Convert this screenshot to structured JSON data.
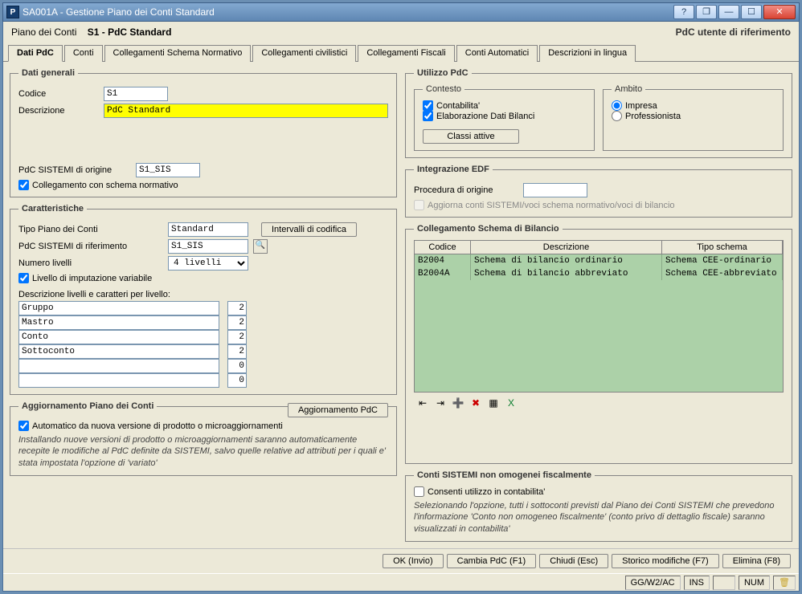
{
  "window": {
    "title": "SA001A - Gestione Piano dei Conti Standard",
    "help_icon": "?",
    "restore_icon": "❐",
    "minimize_icon": "—",
    "maximize_icon": "☐",
    "close_icon": "✕",
    "app_icon": "P"
  },
  "header": {
    "left_label": "Piano dei Conti",
    "code": "S1 -",
    "name": "PdC Standard",
    "right": "PdC utente di riferimento"
  },
  "tabs": {
    "dati_pdc": "Dati PdC",
    "conti": "Conti",
    "coll_schema_norm": "Collegamenti Schema Normativo",
    "coll_civil": "Collegamenti civilistici",
    "coll_fisc": "Collegamenti Fiscali",
    "conti_auto": "Conti Automatici",
    "descr_lingua": "Descrizioni in lingua"
  },
  "dati_generali": {
    "legend": "Dati generali",
    "codice_lbl": "Codice",
    "codice_val": "S1",
    "descr_lbl": "Descrizione",
    "descr_val": "PdC Standard",
    "origine_lbl": "PdC SISTEMI di origine",
    "origine_val": "S1_SIS",
    "chk_coll": "Collegamento con schema normativo"
  },
  "caratteristiche": {
    "legend": "Caratteristiche",
    "tipo_lbl": "Tipo Piano dei Conti",
    "tipo_val": "Standard",
    "intervalli_btn": "Intervalli di codifica",
    "rif_lbl": "PdC SISTEMI di riferimento",
    "rif_val": "S1_SIS",
    "livelli_lbl": "Numero livelli",
    "livelli_val": "4 livelli",
    "chk_imput": "Livello di imputazione variabile",
    "descr_liv_lbl": "Descrizione livelli e caratteri per livello:",
    "levels": [
      {
        "nombre": "Gruppo",
        "num": "2"
      },
      {
        "nombre": "Mastro",
        "num": "2"
      },
      {
        "nombre": "Conto",
        "num": "2"
      },
      {
        "nombre": "Sottoconto",
        "num": "2"
      },
      {
        "nombre": "",
        "num": "0"
      },
      {
        "nombre": "",
        "num": "0"
      }
    ]
  },
  "aggiornamento": {
    "legend": "Aggiornamento Piano dei Conti",
    "btn": "Aggiornamento PdC",
    "chk": "Automatico da nuova versione di prodotto o microaggiornamenti",
    "note": "Installando nuove versioni di prodotto o microaggiornamenti saranno automaticamente recepite le modifiche al PdC definite da SISTEMI, salvo quelle relative ad attributi per i quali e' stata impostata l'opzione di 'variato'"
  },
  "utilizzo": {
    "legend": "Utilizzo PdC",
    "contesto_legend": "Contesto",
    "chk_contab": "Contabilita'",
    "chk_elab": "Elaborazione Dati Bilanci",
    "classi_btn": "Classi attive",
    "ambito_legend": "Ambito",
    "rb_impresa": "Impresa",
    "rb_prof": "Professionista"
  },
  "integrazione": {
    "legend": "Integrazione EDF",
    "proc_lbl": "Procedura di origine",
    "proc_val": "",
    "chk_agg": "Aggiorna conti SISTEMI/voci schema normativo/voci di bilancio"
  },
  "collegamento_schema": {
    "legend": "Collegamento Schema di Bilancio",
    "col_codice": "Codice",
    "col_descr": "Descrizione",
    "col_tipo": "Tipo schema",
    "rows": [
      {
        "codice": "B2004",
        "descr": "Schema di bilancio ordinario",
        "tipo": "Schema CEE-ordinario"
      },
      {
        "codice": "B2004A",
        "descr": "Schema di bilancio abbreviato",
        "tipo": "Schema CEE-abbreviato"
      }
    ]
  },
  "conti_non_omogenei": {
    "legend": "Conti SISTEMI non omogenei fiscalmente",
    "chk": "Consenti utilizzo in contabilita'",
    "note": "Selezionando l'opzione, tutti i sottoconti previsti dal Piano dei Conti SISTEMI che prevedono l'informazione 'Conto non omogeneo fiscalmente' (conto privo di dettaglio fiscale) saranno visualizzati in contabilita'"
  },
  "footer_buttons": {
    "ok": "OK (Invio)",
    "cambia": "Cambia PdC (F1)",
    "chiudi": "Chiudi (Esc)",
    "storico": "Storico modifiche (F7)",
    "elimina": "Elimina (F8)"
  },
  "statusbar": {
    "user": "GG/W2/AC",
    "ins": "INS",
    "num": "NUM"
  }
}
